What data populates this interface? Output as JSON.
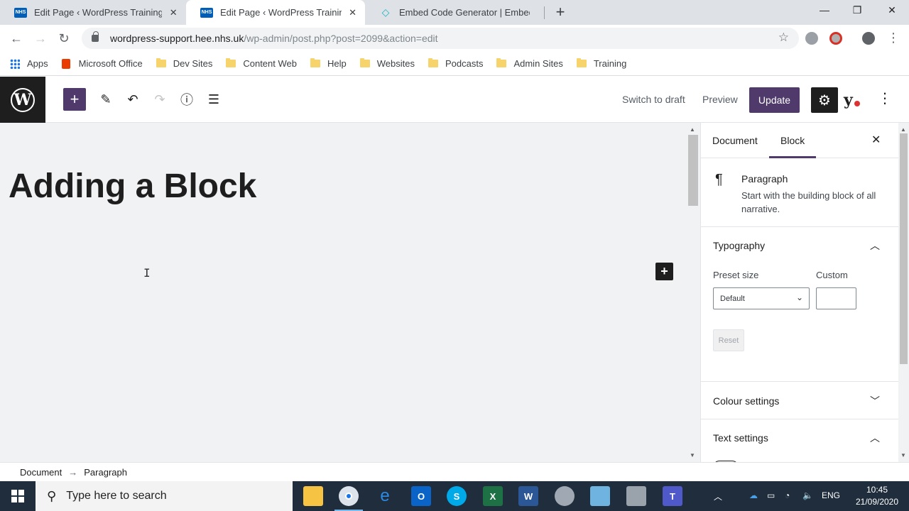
{
  "browser": {
    "tabs": [
      {
        "favicon": "NHS",
        "title": "Edit Page ‹ WordPress Training &",
        "active": false
      },
      {
        "favicon": "NHS",
        "title": "Edit Page ‹ WordPress Training &",
        "active": true
      },
      {
        "favicon": "embed-icon",
        "title": "Embed Code Generator | Embedly",
        "active": false
      }
    ],
    "url_host": "wordpress-support.hee.nhs.uk",
    "url_path": "/wp-admin/post.php?post=2099&action=edit",
    "bookmarks": [
      "Apps",
      "Microsoft Office",
      "Dev Sites",
      "Content Web",
      "Help",
      "Websites",
      "Podcasts",
      "Admin Sites",
      "Training"
    ]
  },
  "editor": {
    "switch_to_draft": "Switch to draft",
    "preview": "Preview",
    "update": "Update",
    "post_title": "Adding a Block"
  },
  "sidebar": {
    "tab_document": "Document",
    "tab_block": "Block",
    "block_name": "Paragraph",
    "block_description": "Start with the building block of all narrative.",
    "typography_label": "Typography",
    "preset_size_label": "Preset size",
    "preset_size_value": "Default",
    "custom_label": "Custom",
    "reset_label": "Reset",
    "colour_settings_label": "Colour settings",
    "text_settings_label": "Text settings"
  },
  "breadcrumbs": {
    "root": "Document",
    "arrow": "→",
    "current": "Paragraph"
  },
  "taskbar": {
    "search_placeholder": "Type here to search",
    "language": "ENG",
    "time": "10:45",
    "date": "21/09/2020"
  },
  "colors": {
    "wp_accent": "#4f3a6b",
    "taskbar_bg": "#1f2d3d"
  }
}
